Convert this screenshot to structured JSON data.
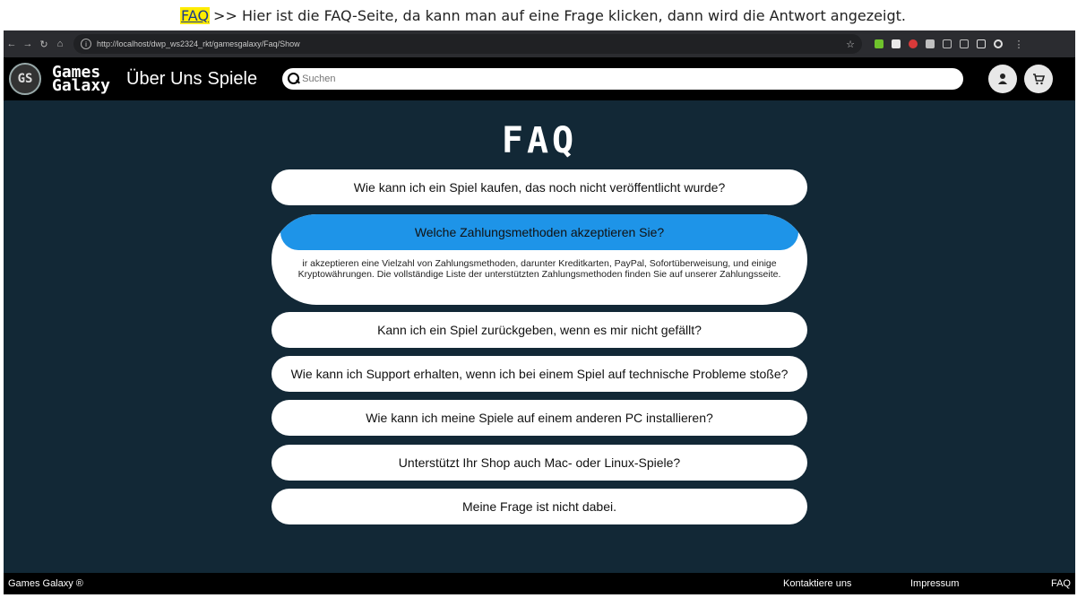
{
  "caption": {
    "highlight": "FAQ",
    "text": ">> Hier ist die FAQ-Seite, da kann man auf eine Frage klicken, dann wird die Antwort angezeigt."
  },
  "browser": {
    "url": "http://localhost/dwp_ws2324_rkt/gamesgalaxy/Faq/Show",
    "extensions": [
      "#6fc32c",
      "#e9e9e9",
      "#d93a3a",
      "#c0c0c0",
      "#bdbdbd"
    ]
  },
  "header": {
    "logo_badge": "GS",
    "logo_line1": "Games",
    "logo_line2": "Galaxy",
    "nav_links": [
      "Über Uns",
      "Spiele"
    ],
    "search_placeholder": "Suchen"
  },
  "main": {
    "title": "FAQ",
    "colors": {
      "background": "#122836",
      "open_question": "#1e94e8"
    },
    "questions": [
      "Wie kann ich ein Spiel kaufen, das noch nicht veröffentlicht wurde?",
      "Welche Zahlungsmethoden akzeptieren Sie?",
      "Kann ich ein Spiel zurückgeben, wenn es mir nicht gefällt?",
      "Wie kann ich Support erhalten, wenn ich bei einem Spiel auf technische Probleme stoße?",
      "Wie kann ich meine Spiele auf einem anderen PC installieren?",
      "Unterstützt Ihr Shop auch Mac- oder Linux-Spiele?",
      "Meine Frage ist nicht dabei."
    ],
    "open_answer": "ir akzeptieren eine Vielzahl von Zahlungsmethoden, darunter Kreditkarten, PayPal, Sofortüberweisung, und einige Kryptowährungen. Die vollständige Liste der unterstützten Zahlungsmethoden finden Sie auf unserer Zahlungsseite."
  },
  "footer": {
    "brand": "Games Galaxy ®",
    "contact": "Kontaktiere uns",
    "impressum": "Impressum",
    "faq": "FAQ"
  }
}
